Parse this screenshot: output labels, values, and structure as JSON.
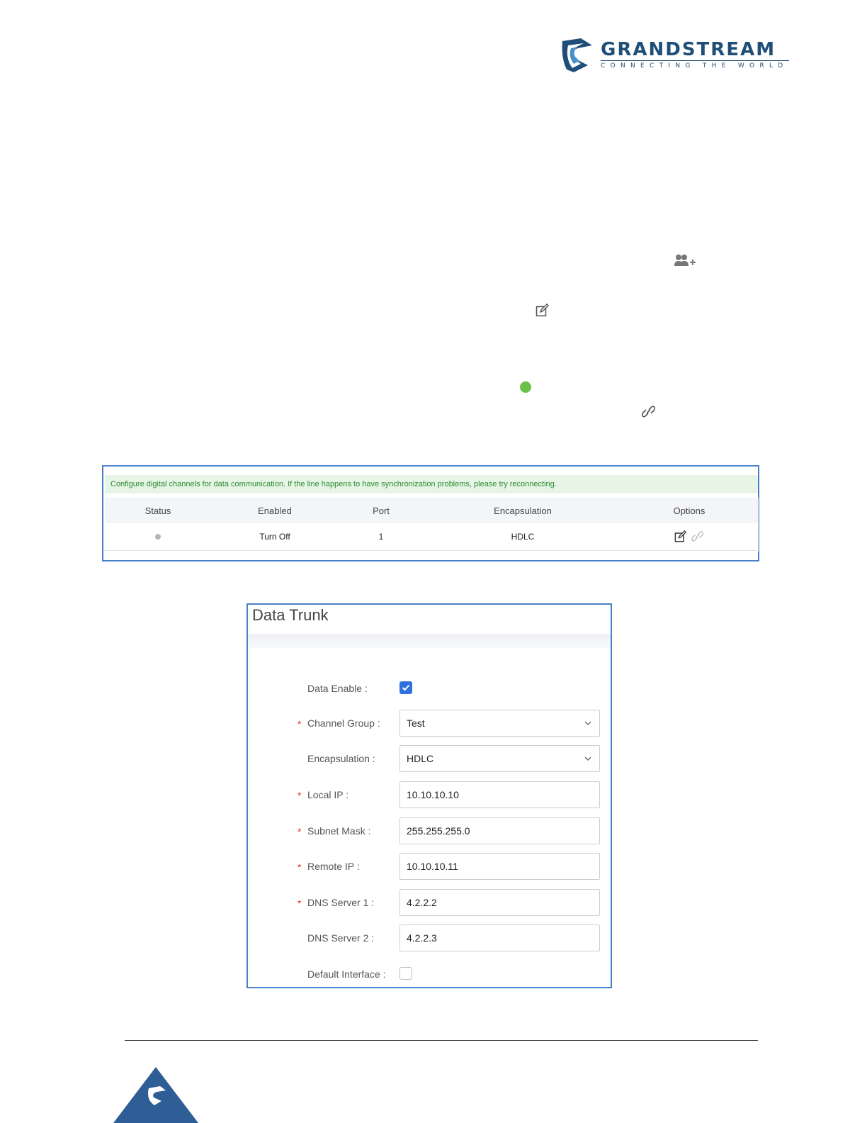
{
  "header": {
    "brand": "GRANDSTREAM",
    "tagline": "CONNECTING THE WORLD"
  },
  "icons": {
    "add_users": "add-users-icon",
    "edit": "edit-icon",
    "status_dot": "status-dot-icon",
    "link": "link-icon"
  },
  "colors": {
    "status_green": "#6cc04a",
    "brand_blue": "#1f4e79",
    "frame_blue": "#4a80c8",
    "notice_bg": "#e6f5e6",
    "notice_text": "#2f8a2f",
    "required": "#e0312e",
    "checkbox_blue": "#2f6fe0"
  },
  "table": {
    "notice": "Configure digital channels for data communication. If the line happens to have synchronization problems, please try reconnecting.",
    "headers": [
      "Status",
      "Enabled",
      "Port",
      "Encapsulation",
      "Options"
    ],
    "row": {
      "status": "",
      "enabled": "Turn Off",
      "port": "1",
      "encapsulation": "HDLC"
    }
  },
  "dialog": {
    "title": "Data Trunk",
    "fields": {
      "data_enable": {
        "label": "Data Enable :",
        "checked": true
      },
      "channel_group": {
        "label": "Channel Group :",
        "value": "Test",
        "required": "*"
      },
      "encapsulation": {
        "label": "Encapsulation :",
        "value": "HDLC"
      },
      "local_ip": {
        "label": "Local IP :",
        "value": "10.10.10.10",
        "required": "*"
      },
      "subnet_mask": {
        "label": "Subnet Mask :",
        "value": "255.255.255.0",
        "required": "*"
      },
      "remote_ip": {
        "label": "Remote IP :",
        "value": "10.10.10.11",
        "required": "*"
      },
      "dns1": {
        "label": "DNS Server 1 :",
        "value": "4.2.2.2",
        "required": "*"
      },
      "dns2": {
        "label": "DNS Server 2 :",
        "value": "4.2.2.3"
      },
      "default_interface": {
        "label": "Default Interface :",
        "checked": false
      }
    }
  }
}
